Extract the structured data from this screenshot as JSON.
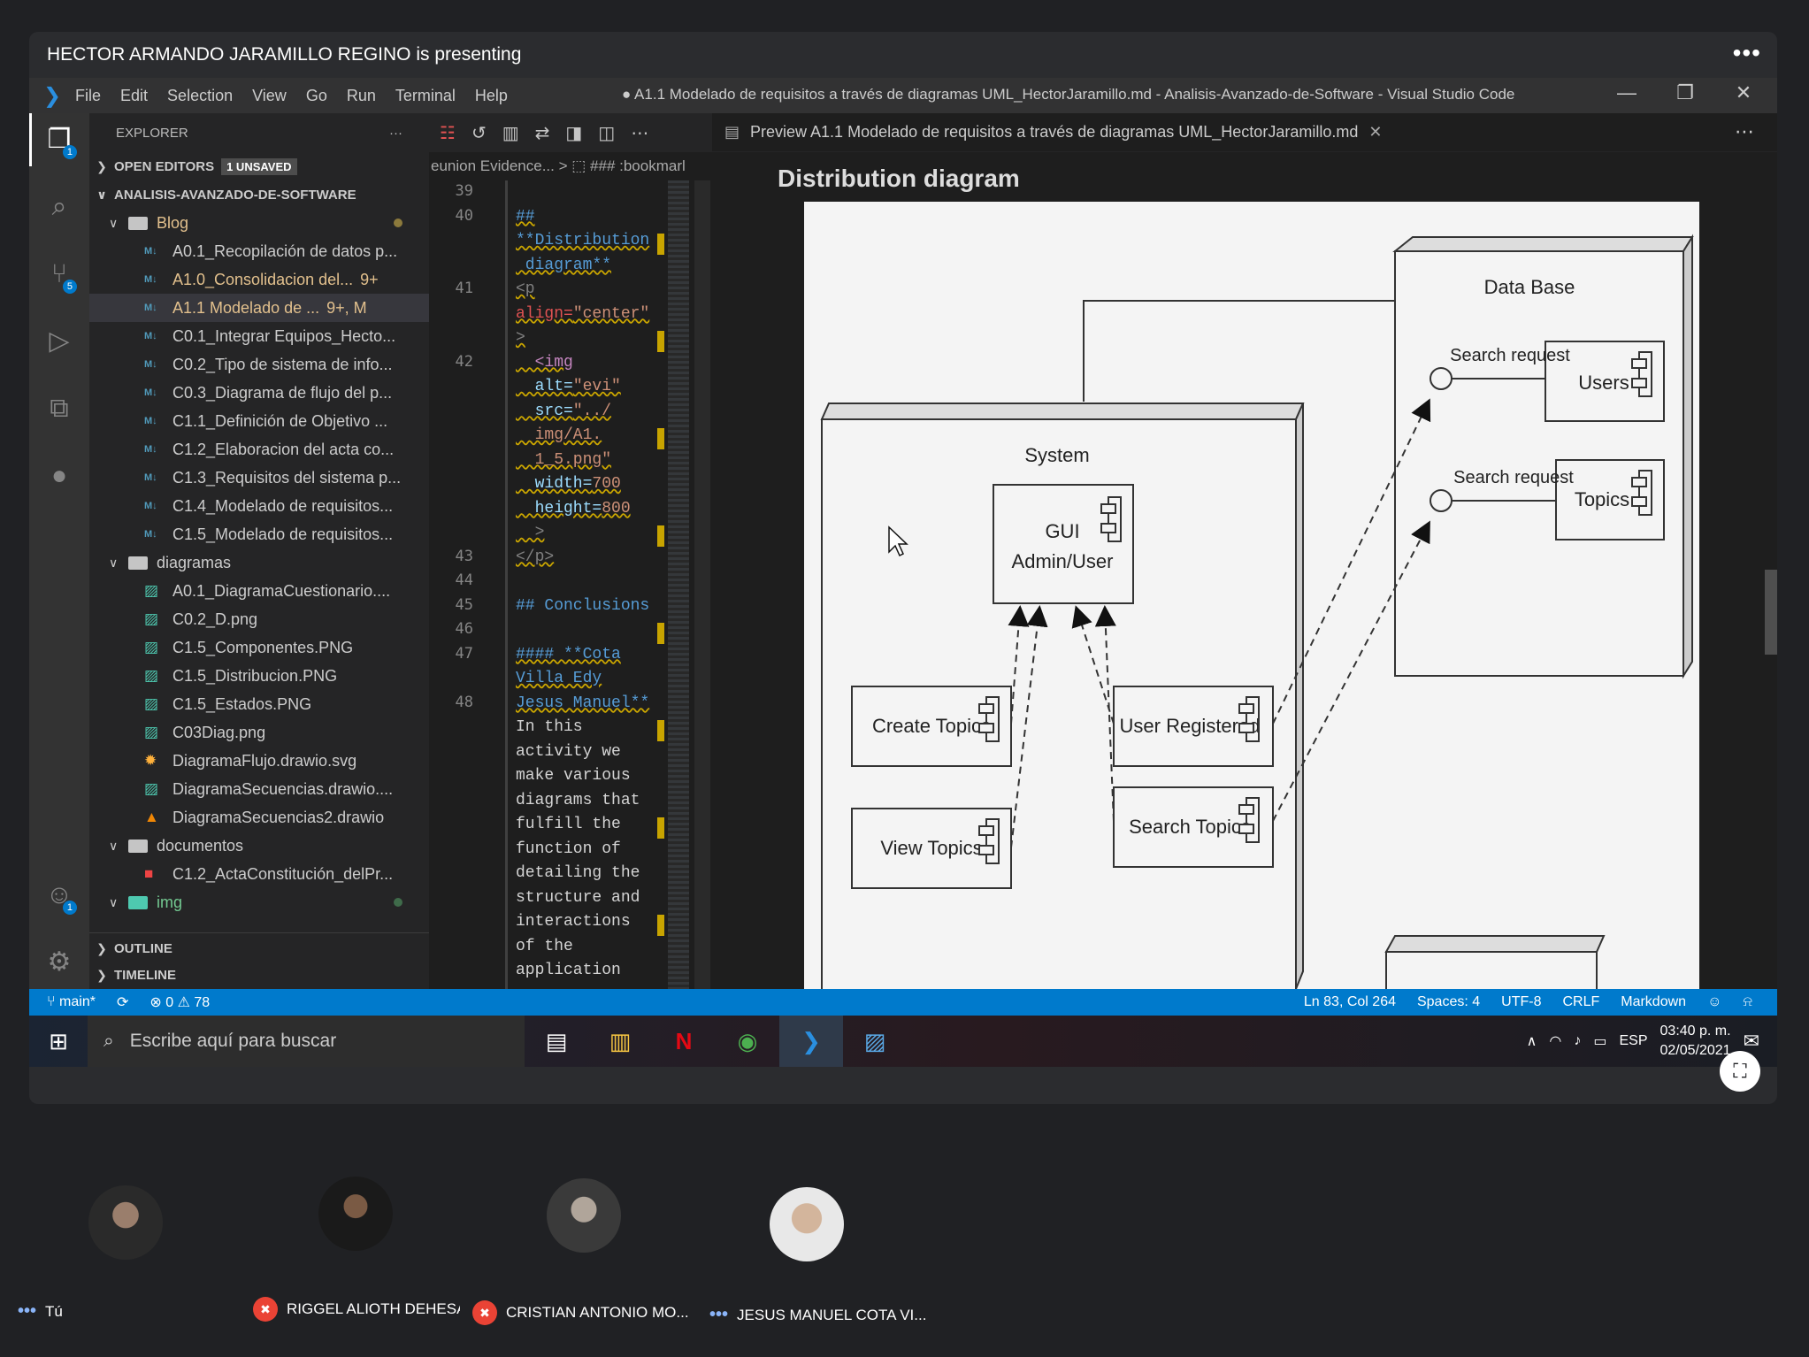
{
  "meet": {
    "presenter_banner": "HECTOR ARMANDO JARAMILLO REGINO is presenting",
    "more_glyph": "•••",
    "participants": [
      {
        "name": "Tú",
        "muted": false
      },
      {
        "name": "RIGGEL ALIOTH DEHESA ...",
        "muted": true
      },
      {
        "name": "CRISTIAN ANTONIO MO...",
        "muted": true
      },
      {
        "name": "JESUS MANUEL COTA VI...",
        "muted": false
      }
    ]
  },
  "vscode": {
    "menu": [
      "File",
      "Edit",
      "Selection",
      "View",
      "Go",
      "Run",
      "Terminal",
      "Help"
    ],
    "window_title": "● A1.1 Modelado de requisitos a través de diagramas UML_HectorJaramillo.md - Analisis-Avanzado-de-Software - Visual Studio Code",
    "activity_badges": {
      "explorer": "1",
      "scm": "5",
      "accounts": "1"
    },
    "explorer": {
      "header": "EXPLORER",
      "open_editors": "OPEN EDITORS",
      "unsaved": "1 UNSAVED",
      "root": "ANALISIS-AVANZADO-DE-SOFTWARE",
      "blog_folder": "Blog",
      "blog_files": [
        {
          "name": "A0.1_Recopilación de datos p...",
          "badge": ""
        },
        {
          "name": "A1.0_Consolidacion del...",
          "badge": "9+"
        },
        {
          "name": "A1.1  Modelado de ...",
          "badge": "9+, M"
        },
        {
          "name": "C0.1_Integrar Equipos_Hecto...",
          "badge": ""
        },
        {
          "name": "C0.2_Tipo de sistema de info...",
          "badge": ""
        },
        {
          "name": "C0.3_Diagrama de flujo del p...",
          "badge": ""
        },
        {
          "name": "C1.1_Definición de Objetivo ...",
          "badge": ""
        },
        {
          "name": "C1.2_Elaboracion del acta co...",
          "badge": ""
        },
        {
          "name": "C1.3_Requisitos del sistema p...",
          "badge": ""
        },
        {
          "name": "C1.4_Modelado de requisitos...",
          "badge": ""
        },
        {
          "name": "C1.5_Modelado de requisitos...",
          "badge": ""
        }
      ],
      "diagramas_folder": "diagramas",
      "diagramas_files": [
        "A0.1_DiagramaCuestionario....",
        "C0.2_D.png",
        "C1.5_Componentes.PNG",
        "C1.5_Distribucion.PNG",
        "C1.5_Estados.PNG",
        "C03Diag.png",
        "DiagramaFlujo.drawio.svg",
        "DiagramaSecuencias.drawio....",
        "DiagramaSecuencias2.drawio"
      ],
      "documentos_folder": "documentos",
      "documentos_files": [
        "C1.2_ActaConstitución_delPr..."
      ],
      "img_folder": "img",
      "outline": "OUTLINE",
      "timeline": "TIMELINE",
      "more": "···"
    },
    "editor": {
      "breadcrumb": "eunion Evidence...  >  ⬚ ### :bookmarl",
      "line_numbers": [
        "39",
        "40",
        "41",
        "42",
        "43",
        "44",
        "45",
        "46",
        "47",
        "48"
      ],
      "code": {
        "l1": "##",
        "l2": "**Distribution",
        "l3": " diagram**",
        "l4": "<p",
        "l5a": "align=",
        "l5b": "\"center\"",
        "l6": ">",
        "l7": "  <img",
        "l8a": "  alt=",
        "l8b": "\"evi\"",
        "l9a": "  src=",
        "l9b": "\"../",
        "l10": "  img/A1.",
        "l11": "  1_5.png\"",
        "l12a": "  width=",
        "l12b": "700",
        "l13a": "  height=",
        "l13b": "800",
        "l14": "  >",
        "l15": "</p>",
        "l16": "",
        "l17": "## Conclusions",
        "l18": "",
        "l19": "#### **Cota",
        "l20": "Villa Edy",
        "l21": "Jesus Manuel**",
        "l22": "In this",
        "l23": "activity we",
        "l24": "make various",
        "l25": "diagrams that",
        "l26": "fulfill the",
        "l27": "function of",
        "l28": "detailing the",
        "l29": "structure and",
        "l30": "interactions",
        "l31": "of the",
        "l32": "application"
      }
    },
    "preview": {
      "tab_label": "Preview A1.1  Modelado de requisitos a través de diagramas UML_HectorJaramillo.md",
      "heading": "Distribution diagram",
      "diagram": {
        "database": "Data Base",
        "search_request_1": "Search request",
        "users": "Users",
        "search_request_2": "Search request",
        "topics": "Topics",
        "system": "System",
        "gui_line1": "GUI",
        "gui_line2": "Admin/User",
        "create_topics": "Create Topics",
        "user_registered": "User Registered",
        "view_topics": "View Topics",
        "search_topics": "Search Topics"
      }
    },
    "status": {
      "branch": "main*",
      "errors": "0",
      "warnings": "78",
      "position": "Ln 83, Col 264",
      "spaces": "Spaces: 4",
      "encoding": "UTF-8",
      "eol": "CRLF",
      "language": "Markdown"
    }
  },
  "taskbar": {
    "search_placeholder": "Escribe aquí para buscar",
    "language": "ESP",
    "time": "03:40 p. m.",
    "date": "02/05/2021"
  }
}
